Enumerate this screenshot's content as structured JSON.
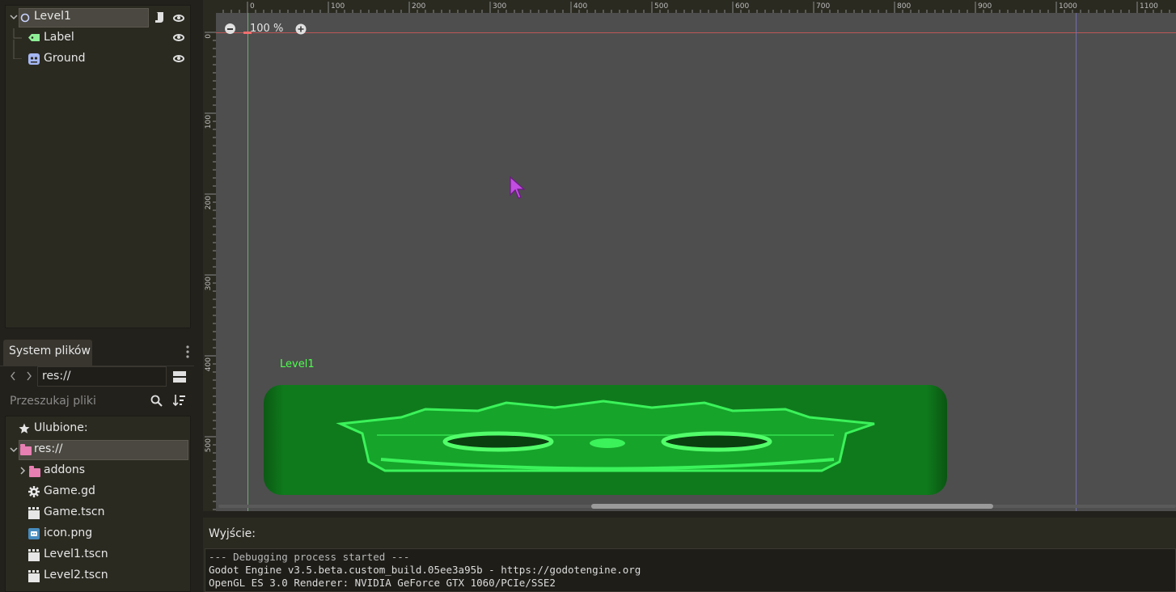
{
  "scene_tree": {
    "root": {
      "label": "Level1"
    },
    "children": [
      {
        "label": "Label",
        "icon": "label-node-icon"
      },
      {
        "label": "Ground",
        "icon": "sprite-node-icon"
      }
    ]
  },
  "filesystem": {
    "tab_label": "System plików",
    "path": "res://",
    "search_placeholder": "Przeszukaj pliki",
    "favorites_label": "Ulubione:",
    "root_label": "res://",
    "items": [
      {
        "label": "addons",
        "icon": "folder-icon"
      },
      {
        "label": "Game.gd",
        "icon": "gear-icon"
      },
      {
        "label": "Game.tscn",
        "icon": "scene-icon"
      },
      {
        "label": "icon.png",
        "icon": "image-icon"
      },
      {
        "label": "Level1.tscn",
        "icon": "scene-icon"
      },
      {
        "label": "Level2.tscn",
        "icon": "scene-icon"
      }
    ]
  },
  "viewport": {
    "zoom_label": "100 %",
    "node_label": "Level1",
    "ruler_top": [
      "0",
      "100",
      "200",
      "300",
      "400",
      "500",
      "600",
      "700",
      "800",
      "900",
      "1000",
      "1100"
    ],
    "ruler_left": [
      "0",
      "100",
      "200",
      "300",
      "400",
      "500"
    ]
  },
  "output": {
    "title": "Wyjście:",
    "lines": [
      "--- Debugging process started ---",
      "Godot Engine v3.5.beta.custom_build.05ee3a95b - https://godotengine.org",
      "OpenGL ES 3.0 Renderer: NVIDIA GeForce GTX 1060/PCIe/SSE2"
    ]
  },
  "colors": {
    "accent_green": "#4cff4c",
    "sprite_green": "#0f7a1c",
    "folder_pink": "#e77fb2"
  }
}
